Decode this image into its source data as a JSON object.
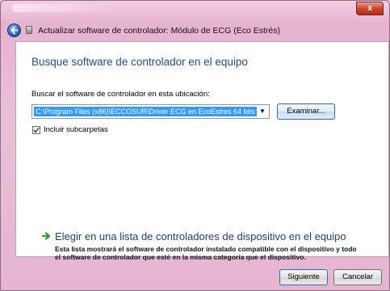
{
  "window": {
    "title": "Actualizar software de controlador: Módulo de ECG (Eco Estrés)",
    "close_glyph": "x"
  },
  "page": {
    "heading": "Busque software de controlador en el equipo",
    "search_label": "Buscar el software de controlador en esta ubicación:",
    "path_value": "C:\\Program Files (x86)\\ECCOSUR\\Driver ECG en EcoEstres 64 bits",
    "browse_label": "Examinar...",
    "include_subfolders_label": "Incluir subcarpetas",
    "include_subfolders_checked": true,
    "option_title": "Elegir en una lista de controladores de dispositivo en el equipo",
    "option_description": "Esta lista mostrará el software de controlador instalado compatible con el dispositivo y todo el software de controlador que esté en la misma categoría que el dispositivo."
  },
  "footer": {
    "next_label": "Siguiente",
    "cancel_label": "Cancelar"
  },
  "icons": {
    "back": "back-arrow-icon",
    "device": "device-icon",
    "dropdown": "chevron-down-icon",
    "option": "green-arrow-icon",
    "check": "checkmark-icon"
  },
  "colors": {
    "frame": "#e7b3d0",
    "heading": "#1f4e8c",
    "selection": "#3399ff",
    "close": "#d0462c"
  }
}
